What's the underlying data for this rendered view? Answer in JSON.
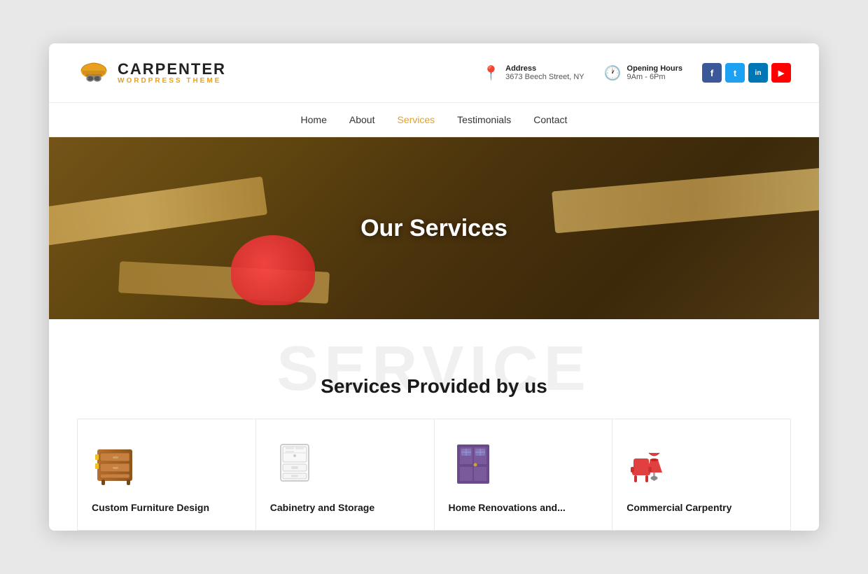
{
  "site": {
    "logo_title": "CARPENTER",
    "logo_subtitle": "WORDPRESS THEME"
  },
  "header": {
    "address_label": "Address",
    "address_value": "3673 Beech Street, NY",
    "hours_label": "Opening Hours",
    "hours_value": "9Am - 6Pm",
    "social": [
      {
        "name": "Facebook",
        "letter": "f",
        "class": "fb"
      },
      {
        "name": "Twitter",
        "letter": "t",
        "class": "tw"
      },
      {
        "name": "LinkedIn",
        "letter": "in",
        "class": "li"
      },
      {
        "name": "YouTube",
        "letter": "▶",
        "class": "yt"
      }
    ]
  },
  "nav": {
    "items": [
      {
        "label": "Home",
        "active": false
      },
      {
        "label": "About",
        "active": false
      },
      {
        "label": "Services",
        "active": true
      },
      {
        "label": "Testimonials",
        "active": false
      },
      {
        "label": "Contact",
        "active": false
      }
    ]
  },
  "hero": {
    "title": "Our Services"
  },
  "services": {
    "bg_text": "SERVICE",
    "heading": "Services Provided by us",
    "cards": [
      {
        "title": "Custom Furniture Design",
        "icon": "furniture"
      },
      {
        "title": "Cabinetry and Storage",
        "icon": "cabinet"
      },
      {
        "title": "Home Renovations and...",
        "icon": "door"
      },
      {
        "title": "Commercial Carpentry",
        "icon": "chair"
      }
    ]
  }
}
